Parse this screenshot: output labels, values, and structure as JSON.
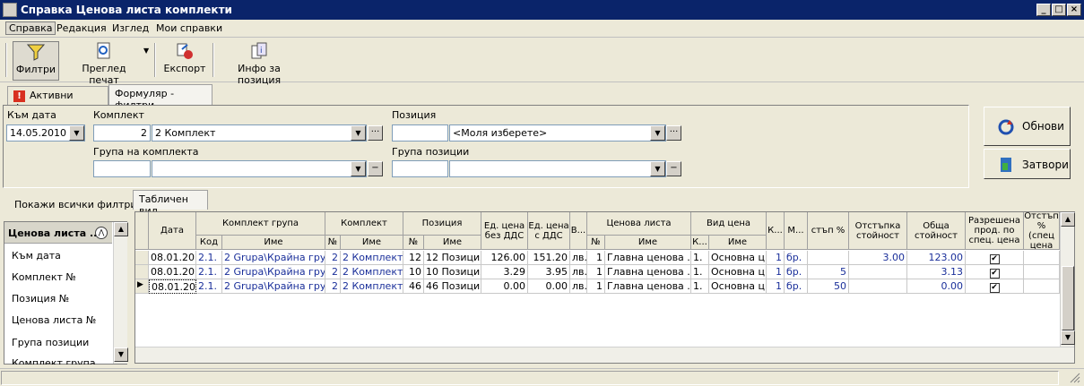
{
  "window": {
    "title": "Справка Ценова листа комплекти"
  },
  "menu": [
    "Справка",
    "Редакция",
    "Изглед",
    "Мои справки"
  ],
  "toolbar": {
    "filters": "Филтри",
    "print_preview": "Преглед печат",
    "export": "Експорт",
    "position_info": "Инфо за позиция"
  },
  "tabs": {
    "active_filters": "Активни филтри",
    "form_filters": "Формуляр - филтри"
  },
  "form": {
    "to_date_label": "Към дата",
    "to_date_value": "14.05.2010",
    "set_label": "Комплект",
    "set_code": "2",
    "set_name": "2 Комплект",
    "position_label": "Позиция",
    "position_code": "",
    "position_name": "<Моля изберете>",
    "set_group_label": "Група на комплекта",
    "position_group_label": "Група позиции"
  },
  "buttons": {
    "refresh": "Обнови",
    "close": "Затвори",
    "show_all_filters": "Покажи всички филтри"
  },
  "view_tab": "Табличен вид",
  "sidelist": {
    "header": "Ценова листа ...",
    "items": [
      "Към дата",
      "Комплект №",
      "Позиция №",
      "Ценова листа №",
      "Група позиции",
      "Комплект група"
    ]
  },
  "table": {
    "headers": {
      "date": "Дата",
      "set_group": "Комплект група",
      "set_group_code": "Код",
      "set_group_name": "Име",
      "set": "Комплект",
      "set_no": "№",
      "set_name": "Име",
      "position": "Позиция",
      "position_no": "№",
      "position_name": "Име",
      "unit_price_excl": "Ед. цена без ДДС",
      "unit_price_incl": "Ед. цена с ДДС",
      "currency": "В...",
      "pricelist": "Ценова листа",
      "pricelist_no": "№",
      "pricelist_name": "Име",
      "price_type": "Вид цена",
      "price_type_code": "К...",
      "price_type_name": "Име",
      "qty": "К...",
      "measure": "М...",
      "discount_pct": "стъп %",
      "discount_value": "Отстъпка стойност",
      "total_value": "Обща стойност",
      "allowed_sale": "Разрешена прод. по спец. цена",
      "spec_discount": "Отстъп % (спец цена"
    },
    "rows": [
      {
        "date": "08.01.20...",
        "sg_code": "2.1.",
        "sg_name": "2 Grupa\\Крайна група",
        "set_no": "2",
        "set_name": "2 Комплект",
        "pos_no": "12",
        "pos_name": "12 Позиция",
        "price_excl": "126.00",
        "price_incl": "151.20",
        "currency": "лв.",
        "pl_no": "1",
        "pl_name": "Главна ценова ...",
        "pt_code": "1.",
        "pt_name": "Основна ц...",
        "qty": "1",
        "measure": "бр.",
        "discount_pct": "",
        "discount_value": "3.00",
        "total": "123.00",
        "allowed": "✔"
      },
      {
        "date": "08.01.20...",
        "sg_code": "2.1.",
        "sg_name": "2 Grupa\\Крайна група",
        "set_no": "2",
        "set_name": "2 Комплект",
        "pos_no": "10",
        "pos_name": "10 Позиция",
        "price_excl": "3.29",
        "price_incl": "3.95",
        "currency": "лв.",
        "pl_no": "1",
        "pl_name": "Главна ценова ...",
        "pt_code": "1.",
        "pt_name": "Основна ц...",
        "qty": "1",
        "measure": "бр.",
        "discount_pct": "5",
        "discount_value": "",
        "total": "3.13",
        "allowed": "✔"
      },
      {
        "date": "08.01.20...",
        "sg_code": "2.1.",
        "sg_name": "2 Grupa\\Крайна група",
        "set_no": "2",
        "set_name": "2 Комплект",
        "pos_no": "46",
        "pos_name": "46 Позиция",
        "price_excl": "0.00",
        "price_incl": "0.00",
        "currency": "лв.",
        "pl_no": "1",
        "pl_name": "Главна ценова ...",
        "pt_code": "1.",
        "pt_name": "Основна ц...",
        "qty": "1",
        "measure": "бр.",
        "discount_pct": "50",
        "discount_value": "",
        "total": "0.00",
        "allowed": "✔"
      }
    ]
  }
}
